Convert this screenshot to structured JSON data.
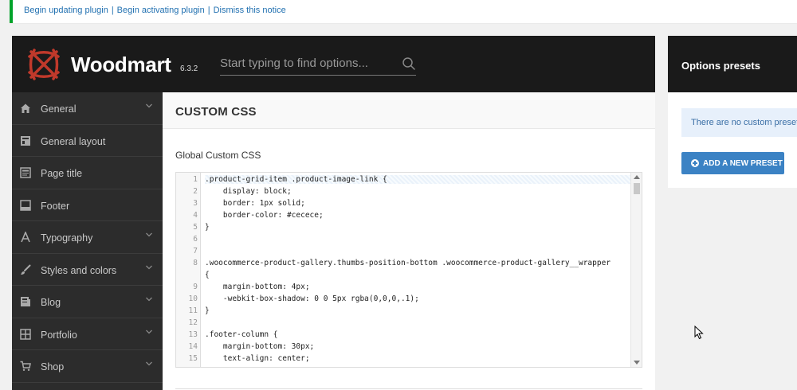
{
  "notice": {
    "links": [
      "Begin updating plugin",
      "Begin activating plugin",
      "Dismiss this notice"
    ],
    "separator": "|",
    "border_color": "#00a32a"
  },
  "header": {
    "brand": "Woodmart",
    "version": "6.3.2",
    "search_placeholder": "Start typing to find options...",
    "logo_color": "#c0392b"
  },
  "sidebar": {
    "items": [
      {
        "label": "General",
        "icon": "home-icon",
        "has_children": true
      },
      {
        "label": "General layout",
        "icon": "layout-icon",
        "has_children": false
      },
      {
        "label": "Page title",
        "icon": "page-title-icon",
        "has_children": false
      },
      {
        "label": "Footer",
        "icon": "footer-icon",
        "has_children": false
      },
      {
        "label": "Typography",
        "icon": "typography-icon",
        "has_children": true
      },
      {
        "label": "Styles and colors",
        "icon": "brush-icon",
        "has_children": true
      },
      {
        "label": "Blog",
        "icon": "blog-icon",
        "has_children": true
      },
      {
        "label": "Portfolio",
        "icon": "portfolio-icon",
        "has_children": true
      },
      {
        "label": "Shop",
        "icon": "cart-icon",
        "has_children": true
      }
    ]
  },
  "main": {
    "section_title": "CUSTOM CSS",
    "field_title": "Global Custom CSS",
    "code_lines": [
      {
        "n": "1",
        "text": ".product-grid-item .product-image-link {"
      },
      {
        "n": "2",
        "text": "    display: block;"
      },
      {
        "n": "3",
        "text": "    border: 1px solid;"
      },
      {
        "n": "4",
        "text": "    border-color: #cecece;"
      },
      {
        "n": "5",
        "text": "}"
      },
      {
        "n": "6",
        "text": ""
      },
      {
        "n": "7",
        "text": ""
      },
      {
        "n": "8",
        "text": ".woocommerce-product-gallery.thumbs-position-bottom .woocommerce-product-gallery__wrapper"
      },
      {
        "n": "",
        "text": "{"
      },
      {
        "n": "9",
        "text": "    margin-bottom: 4px;"
      },
      {
        "n": "10",
        "text": "    -webkit-box-shadow: 0 0 5px rgba(0,0,0,.1);"
      },
      {
        "n": "11",
        "text": "}"
      },
      {
        "n": "12",
        "text": ""
      },
      {
        "n": "13",
        "text": ".footer-column {"
      },
      {
        "n": "14",
        "text": "    margin-bottom: 30px;"
      },
      {
        "n": "15",
        "text": "    text-align: center;"
      }
    ]
  },
  "presets": {
    "title": "Options presets",
    "empty_text": "There are no custom presets",
    "add_button": "ADD A NEW PRESET"
  }
}
